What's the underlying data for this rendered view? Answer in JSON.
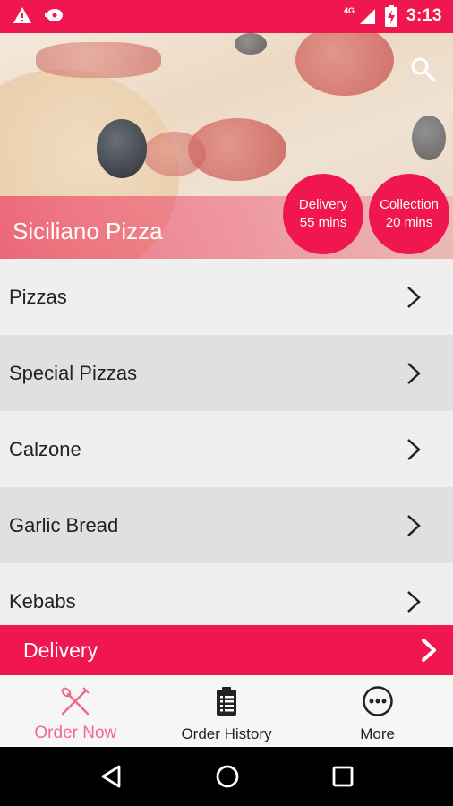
{
  "status_bar": {
    "time": "3:13",
    "network": "4G",
    "icons": [
      "warning-icon",
      "cast-icon",
      "signal-icon",
      "battery-charging-icon"
    ]
  },
  "colors": {
    "accent": "#f0164f",
    "active_tab": "#f06a8c"
  },
  "hero": {
    "title": "Siciliano Pizza",
    "delivery": {
      "label": "Delivery",
      "time": "55 mins"
    },
    "collection": {
      "label": "Collection",
      "time": "20 mins"
    },
    "search_icon": "search-icon"
  },
  "menu": {
    "items": [
      {
        "label": "Pizzas"
      },
      {
        "label": "Special Pizzas"
      },
      {
        "label": "Calzone"
      },
      {
        "label": "Garlic Bread"
      },
      {
        "label": "Kebabs"
      }
    ]
  },
  "order_mode": {
    "label": "Delivery"
  },
  "bottom_nav": {
    "items": [
      {
        "label": "Order Now",
        "icon": "fork-knife-icon",
        "active": true
      },
      {
        "label": "Order History",
        "icon": "clipboard-list-icon",
        "active": false
      },
      {
        "label": "More",
        "icon": "more-dots-icon",
        "active": false
      }
    ]
  },
  "system_nav": {
    "icons": [
      "back-icon",
      "home-icon",
      "recents-icon"
    ]
  }
}
